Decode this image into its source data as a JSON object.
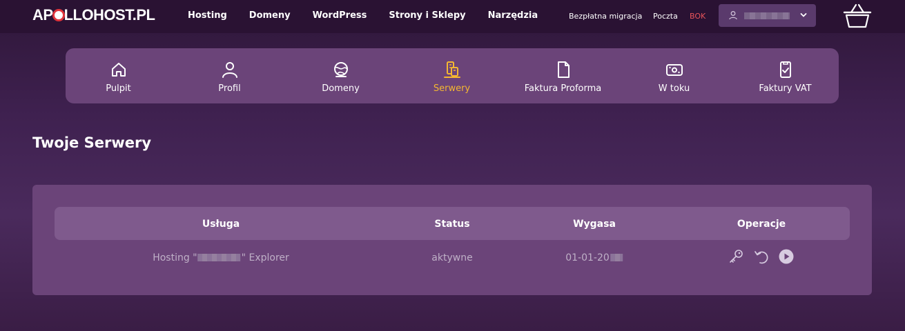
{
  "brand": {
    "logo_prefix": "AP",
    "logo_suffix": "LLOHOST.PL",
    "colors": {
      "accent": "#f5b731",
      "bok": "#e8545a",
      "logo_ring": "#e0343b"
    }
  },
  "topnav": {
    "items": [
      "Hosting",
      "Domeny",
      "WordPress",
      "Strony i Sklepy",
      "Narzędzia"
    ]
  },
  "utility": {
    "migration": "Bezpłatna migracja",
    "mail": "Poczta",
    "bok": "BOK"
  },
  "user_menu": {
    "icon": "user-icon",
    "chevron": "chevron-down-icon"
  },
  "cart": {
    "icon": "basket-icon"
  },
  "iconbar": {
    "items": [
      {
        "label": "Pulpit",
        "icon": "home-icon"
      },
      {
        "label": "Profil",
        "icon": "user-icon"
      },
      {
        "label": "Domeny",
        "icon": "globe-icon"
      },
      {
        "label": "Serwery",
        "icon": "server-icon",
        "active": true
      },
      {
        "label": "Faktura Proforma",
        "icon": "document-icon"
      },
      {
        "label": "W toku",
        "icon": "money-icon"
      },
      {
        "label": "Faktury VAT",
        "icon": "document-check-icon"
      }
    ]
  },
  "page": {
    "title": "Twoje Serwery"
  },
  "table": {
    "columns": [
      "Usługa",
      "Status",
      "Wygasa",
      "Operacje"
    ],
    "rows": [
      {
        "service_prefix": "Hosting \"",
        "service_suffix": "\" Explorer",
        "status": "aktywne",
        "expires": "01-01-20",
        "operations": [
          "key-icon",
          "refresh-icon",
          "play-icon"
        ]
      }
    ]
  }
}
